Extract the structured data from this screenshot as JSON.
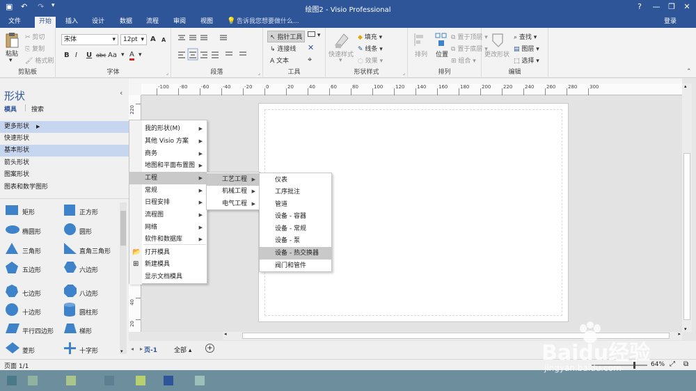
{
  "window": {
    "title": "绘图2 - Visio Professional",
    "quick_access": {
      "undo_icon": "undo-icon",
      "redo_icon": "redo-icon"
    },
    "controls": [
      "?",
      "—",
      "❐",
      "✕"
    ]
  },
  "tabs": [
    "文件",
    "开始",
    "插入",
    "设计",
    "数据",
    "流程",
    "审阅",
    "视图"
  ],
  "tell_me": "告诉我您想要做什么...",
  "login": "登录",
  "ribbon": {
    "clipboard": {
      "paste": "粘贴",
      "cut": "剪切",
      "copy": "复制",
      "format_painter": "格式刷",
      "label": "剪贴板"
    },
    "font": {
      "font_name": "宋体",
      "font_size": "12pt",
      "grow": "A",
      "shrink": "A",
      "bold": "B",
      "italic": "I",
      "underline": "U",
      "strike": "abc",
      "case": "Aa",
      "color": "A",
      "label": "字体"
    },
    "paragraph": {
      "label": "段落"
    },
    "tools": {
      "pointer": "指针工具",
      "connector": "连接线",
      "text": "文本",
      "label": "工具"
    },
    "shape_styles": {
      "quick_styles": "快速样式",
      "fill": "填充",
      "line": "线条",
      "effects": "效果",
      "label": "形状样式"
    },
    "arrange": {
      "align": "排列",
      "position": "位置",
      "bring_front": "置于顶层",
      "send_back": "置于底层",
      "group": "组合",
      "label": "排列"
    },
    "editing": {
      "change_shape": "更改形状",
      "find": "查找",
      "layers": "图层",
      "select": "选择",
      "label": "编辑"
    }
  },
  "shapes_pane": {
    "title": "形状",
    "tab_stencils": "模具",
    "tab_search": "搜索",
    "collapse": "‹",
    "categories": [
      "更多形状",
      "快速形状",
      "基本形状",
      "箭头形状",
      "图案形状",
      "图表和数学图形"
    ],
    "shapes": [
      "矩形",
      "正方形",
      "椭圆形",
      "圆形",
      "三角形",
      "直角三角形",
      "五边形",
      "六边形",
      "七边形",
      "八边形",
      "十边形",
      "圆柱形",
      "平行四边形",
      "梯形",
      "菱形",
      "十字形"
    ]
  },
  "ruler": {
    "h_ticks": [
      "-100",
      "-80",
      "-60",
      "-40",
      "-20",
      "0",
      "20",
      "40",
      "60",
      "80",
      "100",
      "120",
      "140",
      "160",
      "180",
      "200",
      "220",
      "240",
      "260",
      "280",
      "300"
    ],
    "v_ticks": [
      "220",
      "200",
      "180",
      "160",
      "140",
      "120",
      "100",
      "80",
      "60",
      "40",
      "20"
    ]
  },
  "menu_more": [
    {
      "label": "我的形状(M)",
      "sub": true
    },
    {
      "label": "其他 Visio 方案",
      "sub": true
    },
    {
      "label": "商务",
      "sub": true
    },
    {
      "label": "地图和平面布置图",
      "sub": true
    },
    {
      "label": "工程",
      "sub": true
    },
    {
      "label": "常规",
      "sub": true
    },
    {
      "label": "日程安排",
      "sub": true
    },
    {
      "label": "流程图",
      "sub": true
    },
    {
      "label": "网络",
      "sub": true
    },
    {
      "label": "软件和数据库",
      "sub": true
    },
    {
      "label": "打开模具",
      "sub": false
    },
    {
      "label": "新建模具",
      "sub": false
    },
    {
      "label": "显示文档模具",
      "sub": false
    }
  ],
  "menu_engineering": [
    {
      "label": "工艺工程",
      "sub": true
    },
    {
      "label": "机械工程",
      "sub": true
    },
    {
      "label": "电气工程",
      "sub": true
    }
  ],
  "menu_process": [
    "仪表",
    "工序批注",
    "管道",
    "设备 - 容器",
    "设备 - 常规",
    "设备 - 泵",
    "设备 - 热交换器",
    "阀门和管件"
  ],
  "page_tabs": {
    "page": "页-1",
    "all": "全部 ▴",
    "add": "+"
  },
  "status": {
    "page_info": "页面 1/1",
    "zoom": "64%"
  },
  "watermark": {
    "brand": "Baidu经验",
    "url": "jingyan.baidu.com"
  }
}
